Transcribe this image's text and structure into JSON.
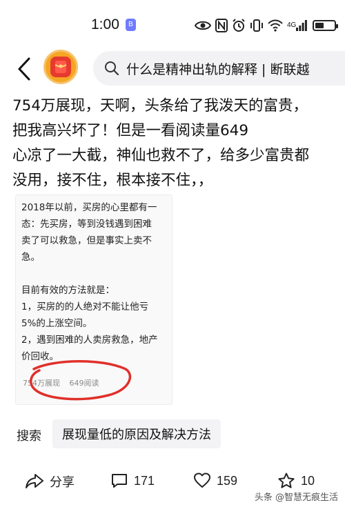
{
  "status_bar": {
    "time": "1:00",
    "badge": "B",
    "network_label": "4G",
    "icons": [
      "eye-icon",
      "nfc-icon",
      "alarm-icon",
      "vibrate-icon",
      "wifi-icon",
      "signal-icon",
      "battery-icon"
    ]
  },
  "header": {
    "search_text": "什么是精神出轨的解释 | 断联越"
  },
  "post": {
    "lines": [
      "754万展现，天啊，头条给了我泼天的富贵，",
      "把我高兴坏了！但是一看阅读量649",
      "心凉了一大截，神仙也救不了，给多少富贵都",
      "没用，接不住，根本接不住，，"
    ]
  },
  "embed": {
    "lines": [
      "2018年以前，买房的心里都有一",
      "态：先买房，等到没钱遇到困难",
      "卖了可以救急，但是事实上卖不",
      "急。",
      "",
      "目前有效的方法就是：",
      "1，买房的的人绝对不能让他亏",
      "5%的上涨空间。",
      "2，遇到困难的人卖房救急，地产",
      "价回收。"
    ],
    "impressions": "754万展现",
    "reads": "649阅读"
  },
  "suggestion": {
    "label": "搜索",
    "chip": "展现量低的原因及解决方法"
  },
  "actions": {
    "share": "分享",
    "comments": "171",
    "likes": "159",
    "favorites": "10"
  },
  "watermark": "头条 @智慧无痕生活",
  "colors": {
    "accent_red": "#e63a2e",
    "logo_orange": "#f5a623",
    "circle_red": "#e0302a"
  }
}
